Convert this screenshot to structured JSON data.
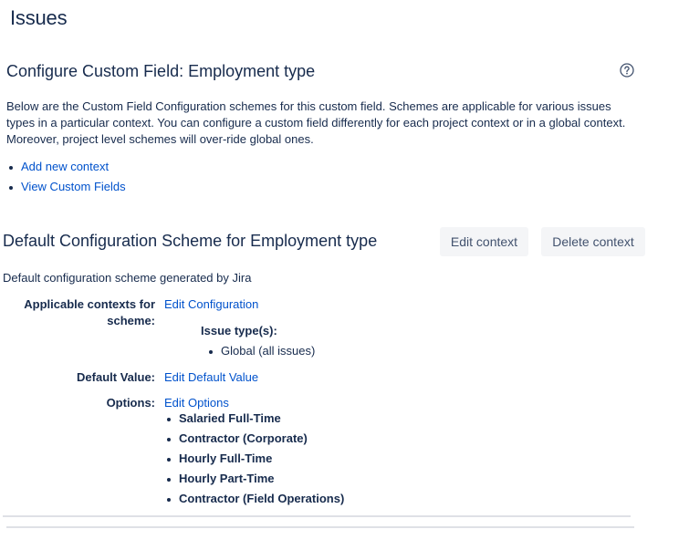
{
  "page": {
    "title": "Issues"
  },
  "configure": {
    "title": "Configure Custom Field: Employment type",
    "help_icon": "question-circle-icon",
    "description": "Below are the Custom Field Configuration schemes for this custom field. Schemes are applicable for various issues types in a particular context. You can configure a custom field differently for each project context or in a global context. Moreover, project level schemes will over-ride global ones.",
    "links": [
      "Add new context",
      "View Custom Fields"
    ]
  },
  "scheme": {
    "title": "Default Configuration Scheme for Employment type",
    "edit_context_label": "Edit context",
    "delete_context_label": "Delete context",
    "description": "Default configuration scheme generated by Jira",
    "contexts_label_line1": "Applicable contexts for",
    "contexts_label_line2": "scheme:",
    "edit_configuration_label": "Edit Configuration",
    "issue_types_label": "Issue type(s):",
    "issue_types": [
      "Global (all issues)"
    ],
    "default_value_label": "Default Value:",
    "edit_default_value_label": "Edit Default Value",
    "options_label": "Options:",
    "edit_options_label": "Edit Options",
    "options": [
      "Salaried Full-Time",
      "Contractor (Corporate)",
      "Hourly Full-Time",
      "Hourly Part-Time",
      "Contractor (Field Operations)"
    ]
  },
  "colors": {
    "text": "#172b4d",
    "link": "#0052cc",
    "button_bg": "#f4f5f7",
    "button_text": "#42526e",
    "divider": "#dfe1e6"
  }
}
